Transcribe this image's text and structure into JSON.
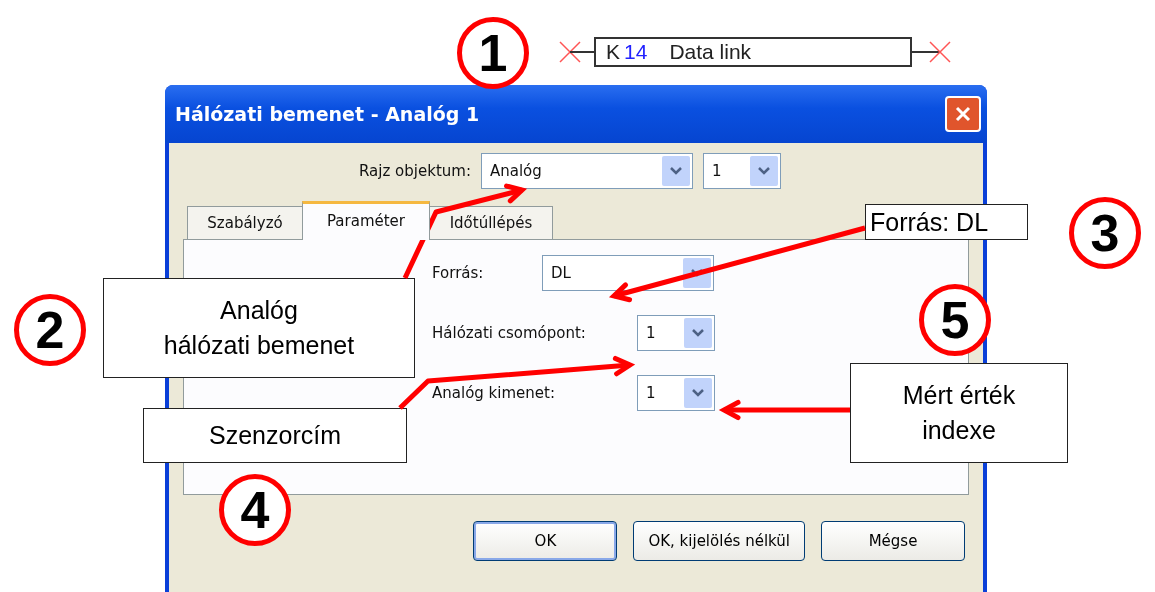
{
  "component_block": {
    "prefix": "K",
    "number": "14",
    "label": "Data link"
  },
  "window": {
    "title": "Hálózati bemenet - Analóg 1"
  },
  "drawing_object": {
    "label": "Rajz objektum:",
    "value": "Analóg",
    "number": "1"
  },
  "tabs": [
    {
      "label": "Szabályzó",
      "selected": false
    },
    {
      "label": "Paraméter",
      "selected": true
    },
    {
      "label": "Időtúllépés",
      "selected": false
    }
  ],
  "fields": [
    {
      "label": "Forrás:",
      "value": "DL",
      "kind": "wide"
    },
    {
      "label": "Hálózati csomópont:",
      "value": "1",
      "kind": "narrow"
    },
    {
      "label": "Analóg kimenet:",
      "value": "1",
      "kind": "narrow"
    }
  ],
  "buttons": [
    {
      "label": "OK",
      "default": true
    },
    {
      "label": "OK, kijelölés nélkül",
      "default": false
    },
    {
      "label": "Mégse",
      "default": false
    }
  ],
  "markers": [
    "1",
    "2",
    "3",
    "4",
    "5"
  ],
  "callouts": [
    {
      "lines": [
        "Analóg",
        "hálózati bemenet"
      ]
    },
    {
      "lines": [
        "Forrás: DL"
      ]
    },
    {
      "lines": [
        "Szenzorcím"
      ]
    },
    {
      "lines": [
        "Mért érték",
        "indexe"
      ]
    }
  ]
}
